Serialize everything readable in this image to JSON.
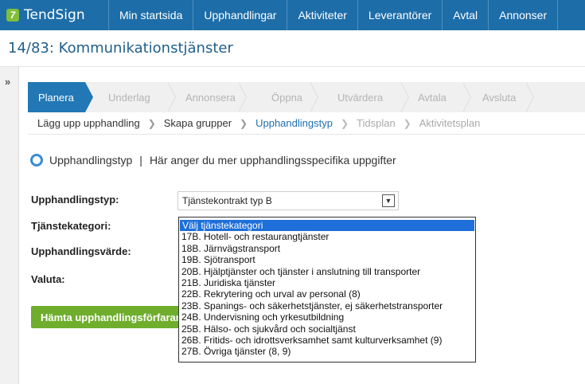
{
  "app": {
    "logo_mark": "7",
    "logo_text": "TendSign"
  },
  "nav": [
    "Min startsida",
    "Upphandlingar",
    "Aktiviteter",
    "Leverantörer",
    "Avtal",
    "Annonser"
  ],
  "page_title": "14/83: Kommunikationstjänster",
  "sidebar": {
    "toggle": "»"
  },
  "steps": [
    "Planera",
    "Underlag",
    "Annonsera",
    "Öppna",
    "Utvärdera",
    "Avtala",
    "Avsluta"
  ],
  "substeps": [
    "Lägg upp upphandling",
    "Skapa grupper",
    "Upphandlingstyp",
    "Tidsplan",
    "Aktivitetsplan"
  ],
  "section": {
    "title": "Upphandlingstyp",
    "separator": "|",
    "description": "Här anger du mer upphandlingsspecifika uppgifter"
  },
  "form": {
    "type_label": "Upphandlingstyp:",
    "type_value": "Tjänstekontrakt typ B",
    "category_label": "Tjänstekategori:",
    "value_label": "Upphandlingsvärde:",
    "currency_label": "Valuta:",
    "fetch_button": "Hämta upphandlingsförfarande"
  },
  "dropdown": {
    "options": [
      "Välj tjänstekategori",
      "17B. Hotell- och restaurangtjänster",
      "18B. Järnvägstransport",
      "19B. Sjötransport",
      "20B. Hjälptjänster och tjänster i anslutning till transporter",
      "21B. Juridiska tjänster",
      "22B. Rekrytering och urval av personal (8)",
      "23B. Spanings- och säkerhetstjänster, ej säkerhetstransporter",
      "24B. Undervisning och yrkesutbildning",
      "25B. Hälso- och sjukvård och socialtjänst",
      "26B. Fritids- och idrottsverksamhet samt kulturverksamhet (9)",
      "27B. Övriga tjänster (8, 9)"
    ],
    "selected_index": 0
  },
  "colors": {
    "nav": "#1d6da8",
    "accent": "#2278b5",
    "button": "#6fae2c",
    "selection": "#1e6fd9"
  }
}
